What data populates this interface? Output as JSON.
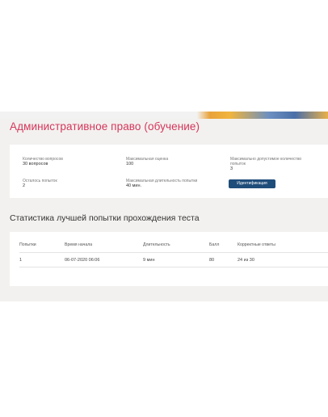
{
  "course": {
    "title": "Административное право (обучение)"
  },
  "info": {
    "questions_count": {
      "label": "Количество вопросов",
      "value": "30 вопросов"
    },
    "max_score": {
      "label": "Максимальная оценка",
      "value": "100"
    },
    "max_attempts": {
      "label": "Максимально допустимое количество",
      "label2": "попыток",
      "value": "3"
    },
    "attempts_left": {
      "label": "Осталось попыток",
      "value": "2"
    },
    "max_duration": {
      "label": "Максимальная длительность попытки",
      "value": "40 мин."
    },
    "identification_button": "Идентификация"
  },
  "stats": {
    "title": "Статистика лучшей попытки прохождения теста",
    "columns": [
      "Попытки",
      "Время начала",
      "Длительность",
      "Балл",
      "Корректные ответы"
    ],
    "rows": [
      [
        "1",
        "06-07-2020 06:06",
        "9 мин",
        "80",
        "24 из 30"
      ]
    ]
  },
  "colors": {
    "title_accent": "#d4365b",
    "button_bg": "#1f4d7a",
    "panel_bg": "#f3f1ef"
  }
}
